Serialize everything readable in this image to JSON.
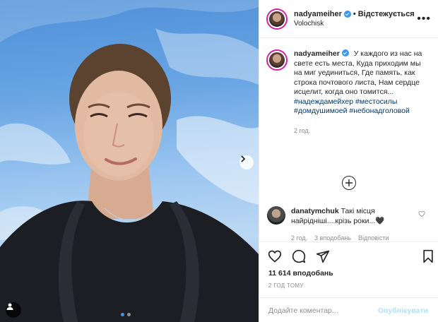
{
  "header": {
    "username": "nadyameiher",
    "separator": "•",
    "follow_state": "Відстежується",
    "location": "Volochisk",
    "more_icon": "more-horizontal-icon"
  },
  "caption": {
    "username": "nadyameiher",
    "text": "У каждого из нас на свете есть места, Куда приходим мы на миг уединиться, Где память, как строка почтового листа, Нам сердце исцелит, когда оно томится...",
    "hashtags": [
      "#надеждамейхер",
      "#местосилы",
      "#домдушимоей",
      "#небонадголовой"
    ],
    "time": "2 год."
  },
  "comment": {
    "username": "danatymchuk",
    "text": "Такі місця найрідніші....крізь роки...🖤",
    "time": "2 год.",
    "likes": "3 вподобань",
    "reply": "Відповісти"
  },
  "actions": {
    "likes_count": "11 614 вподобань",
    "posted": "2 ГОД ТОМУ",
    "comment_placeholder": "Додайте коментар...",
    "publish_label": "Опублікувати"
  },
  "carousel": {
    "current": 1,
    "total": 2
  },
  "colors": {
    "accent": "#3897f0",
    "link": "#00376b",
    "muted": "#8e8e8e"
  }
}
